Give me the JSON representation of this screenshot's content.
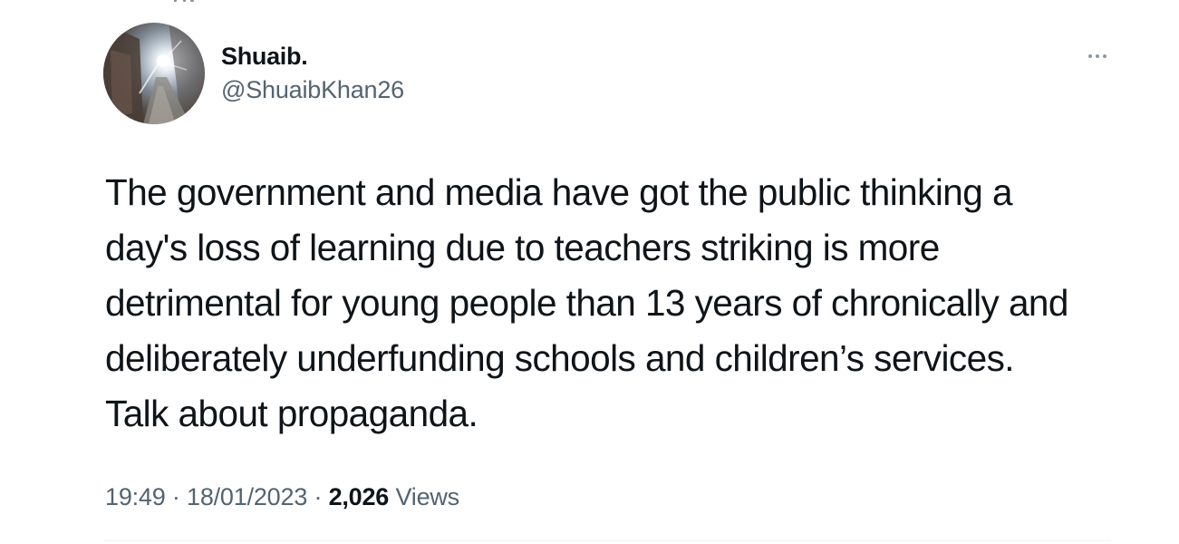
{
  "author": {
    "display_name": "Shuaib.",
    "handle": "@ShuaibKhan26",
    "avatar_icon": "profile-photo"
  },
  "more_icon": "more-horizontal-icon",
  "tweet": {
    "lines": [
      "The government and media have got the public thinking a",
      "day's loss of learning due to teachers striking is more",
      "detrimental for young people than 13 years of chronically and",
      "deliberately underfunding schools and children’s services.",
      "Talk about propaganda."
    ]
  },
  "meta": {
    "time": "19:49",
    "separator": "·",
    "date": "18/01/2023",
    "views_count": "2,026",
    "views_label": "Views"
  },
  "colors": {
    "text_primary": "#0f1419",
    "text_secondary": "#536471",
    "divider": "#eff3f4",
    "background": "#ffffff"
  }
}
